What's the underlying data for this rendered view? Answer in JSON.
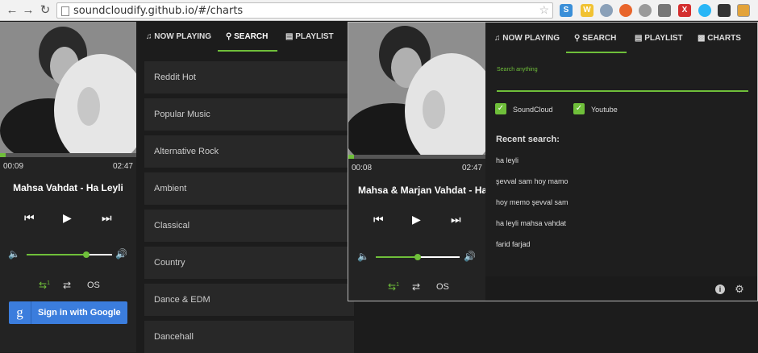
{
  "browser": {
    "url": "soundcloudify.github.io/#/charts",
    "back_icon": "arrow-left-icon",
    "forward_icon": "arrow-right-icon",
    "reload_icon": "reload-icon",
    "ext_s": "S",
    "ext_w": "W",
    "ext_x": "X"
  },
  "left_player": {
    "elapsed": "00:09",
    "duration": "02:47",
    "progress": 0.04,
    "track_title": "Mahsa Vahdat - Ha Leyli",
    "volume": 0.7,
    "repeat_badge": "1",
    "os_label": "OS",
    "google_label": "Sign in with Google",
    "google_letter": "g"
  },
  "main_tabs": [
    {
      "label": "NOW PLAYING",
      "icon": "music-note-icon"
    },
    {
      "label": "SEARCH",
      "icon": "search-icon",
      "active": true
    },
    {
      "label": "PLAYLIST",
      "icon": "playlist-icon"
    }
  ],
  "charts": [
    "Reddit Hot",
    "Popular Music",
    "Alternative Rock",
    "Ambient",
    "Classical",
    "Country",
    "Dance & EDM",
    "Dancehall"
  ],
  "popup": {
    "elapsed": "00:08",
    "duration": "02:47",
    "progress": 0.04,
    "track_title": "Mahsa & Marjan Vahdat - Ha",
    "volume": 0.5,
    "repeat_badge": "1",
    "os_label": "OS",
    "tabs": [
      {
        "label": "NOW PLAYING",
        "icon": "music-note-icon"
      },
      {
        "label": "SEARCH",
        "icon": "search-icon",
        "active": true
      },
      {
        "label": "PLAYLIST",
        "icon": "playlist-icon"
      },
      {
        "label": "CHARTS",
        "icon": "bar-chart-icon"
      }
    ],
    "search_label": "Search anything",
    "search_value": "",
    "sources": [
      {
        "label": "SoundCloud",
        "checked": true
      },
      {
        "label": "Youtube",
        "checked": true
      }
    ],
    "recent_title": "Recent search:",
    "recent": [
      "ha leyli",
      "şevval sam hoy mamo",
      "hoy memo şevval sam",
      "ha leyli mahsa vahdat",
      "farid farjad"
    ]
  },
  "colors": {
    "accent": "#6fbf3a",
    "background": "#1c1c1c",
    "google": "#3b7ddd"
  }
}
